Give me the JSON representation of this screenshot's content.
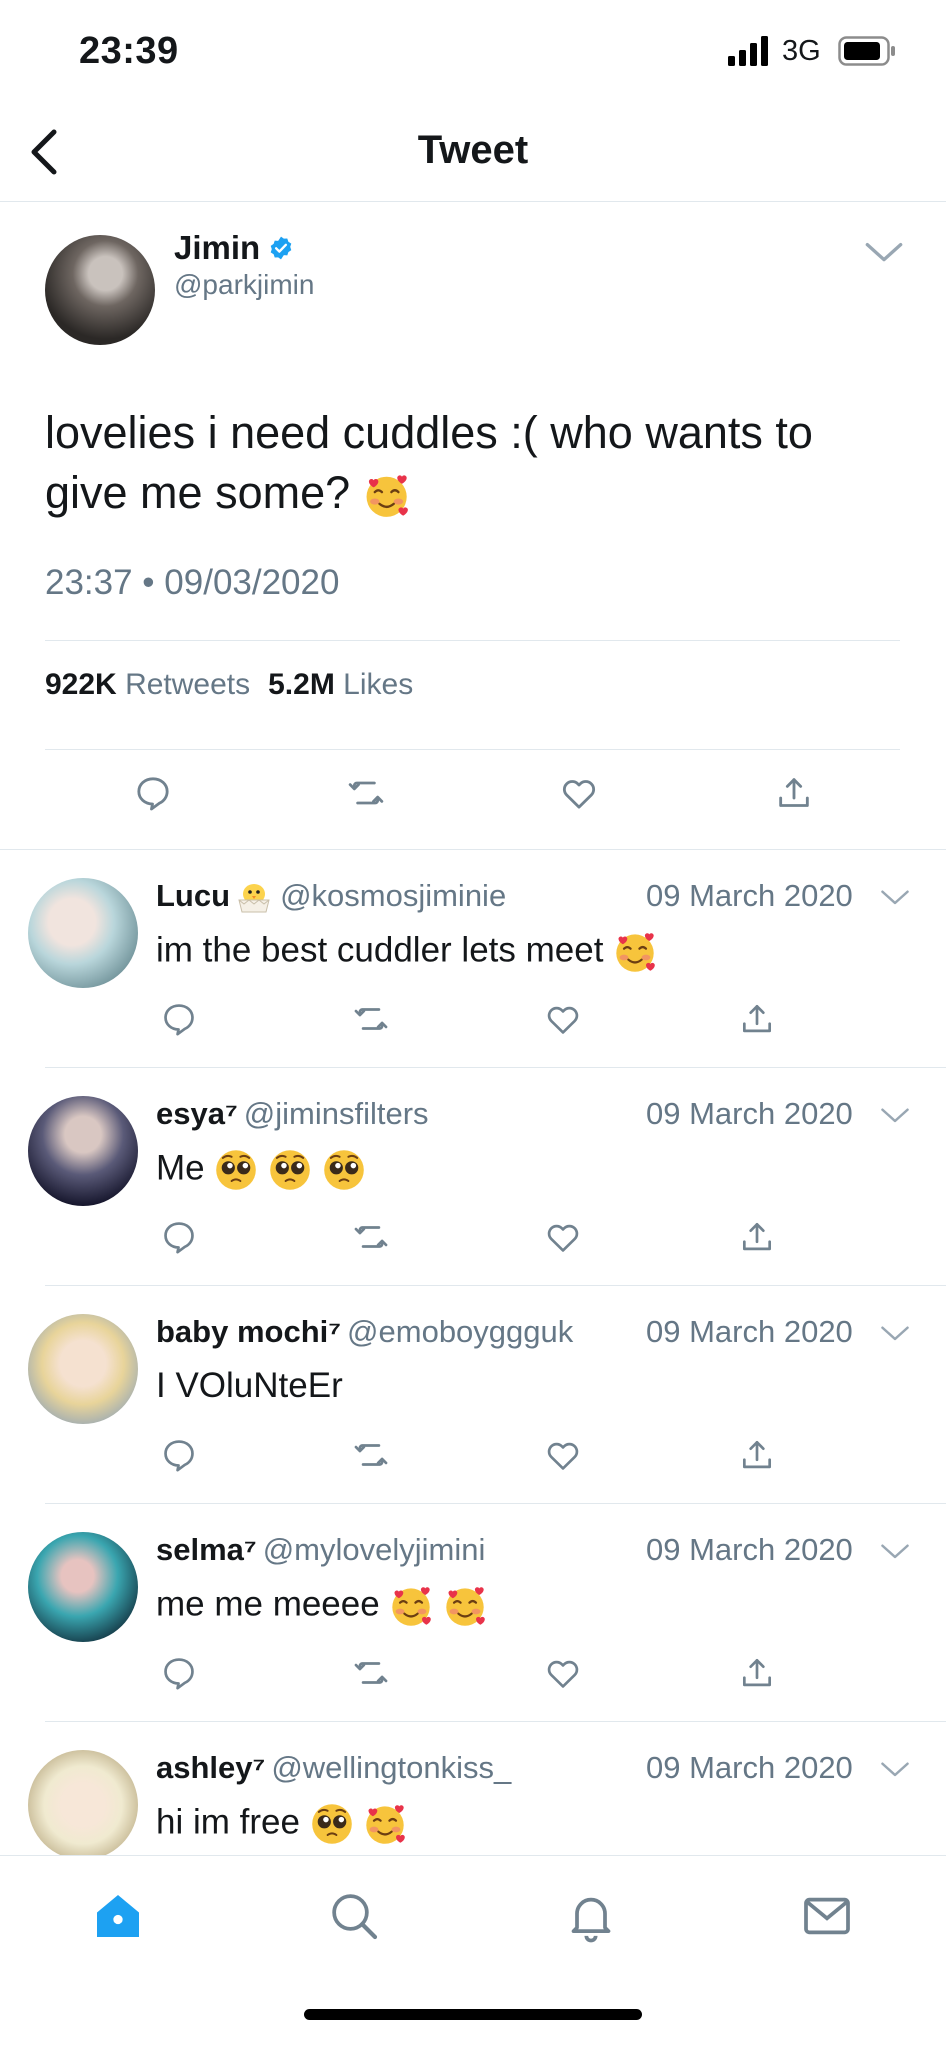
{
  "status_bar": {
    "time": "23:39",
    "network": "3G"
  },
  "nav": {
    "title": "Tweet"
  },
  "tweet": {
    "name": "Jimin",
    "handle": "@parkjimin",
    "text": "lovelies i need cuddles :( who wants to give me some?",
    "timestamp": "23:37 • 09/03/2020",
    "retweets_count": "922K",
    "retweets_label": "Retweets",
    "likes_count": "5.2M",
    "likes_label": "Likes"
  },
  "replies": [
    {
      "name": "Lucu",
      "handle": "@kosmosjiminie",
      "date": "09 March 2020",
      "text": "im the best cuddler lets meet"
    },
    {
      "name": "esya⁷",
      "handle": "@jiminsfilters",
      "date": "09 March 2020",
      "text": "Me"
    },
    {
      "name": "baby mochi⁷",
      "handle": "@emoboyggguk",
      "date": "09 March 2020",
      "text": "I VOluNteEr"
    },
    {
      "name": "selma⁷",
      "handle": "@mylovelyjimini",
      "date": "09 March 2020",
      "text": "me me meeee"
    },
    {
      "name": "ashley⁷",
      "handle": "@wellingtonkiss_",
      "date": "09 March 2020",
      "text": "hi im free"
    }
  ],
  "colors": {
    "accent": "#1da1f2",
    "muted": "#657786",
    "icon": "#71828f",
    "divider": "#e1e8ed"
  },
  "icons": {
    "tabs": [
      "home-icon",
      "search-icon",
      "bell-icon",
      "mail-icon"
    ],
    "actions": [
      "reply-icon",
      "retweet-icon",
      "like-icon",
      "share-icon"
    ]
  }
}
